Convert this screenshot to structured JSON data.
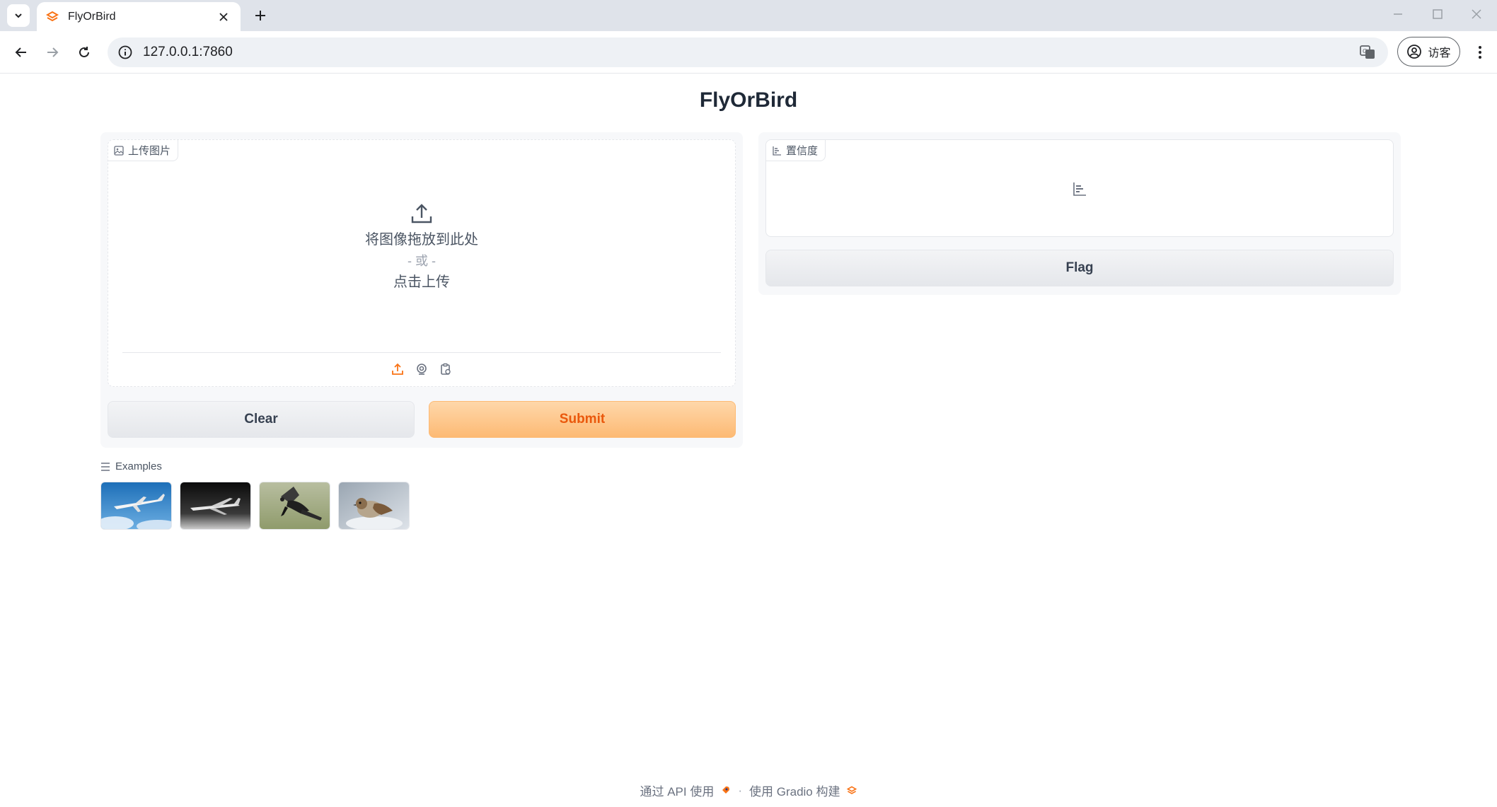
{
  "browser": {
    "tab_title": "FlyOrBird",
    "url": "127.0.0.1:7860",
    "profile_label": "访客"
  },
  "app": {
    "title": "FlyOrBird"
  },
  "input_image": {
    "label": "上传图片",
    "drop_text": "将图像拖放到此处",
    "or_text": "- 或 -",
    "click_text": "点击上传"
  },
  "buttons": {
    "clear": "Clear",
    "submit": "Submit",
    "flag": "Flag"
  },
  "output": {
    "label": "置信度"
  },
  "examples": {
    "label": "Examples",
    "items": [
      "airplane-sky",
      "airplane-dark",
      "bird-crow",
      "bird-sparrow"
    ]
  },
  "footer": {
    "api_text": "通过 API 使用",
    "separator": "·",
    "built_text": "使用 Gradio 构建"
  },
  "colors": {
    "accent": "#f97316",
    "primary_button_from": "#fed7aa",
    "primary_button_to": "#fdba74"
  }
}
